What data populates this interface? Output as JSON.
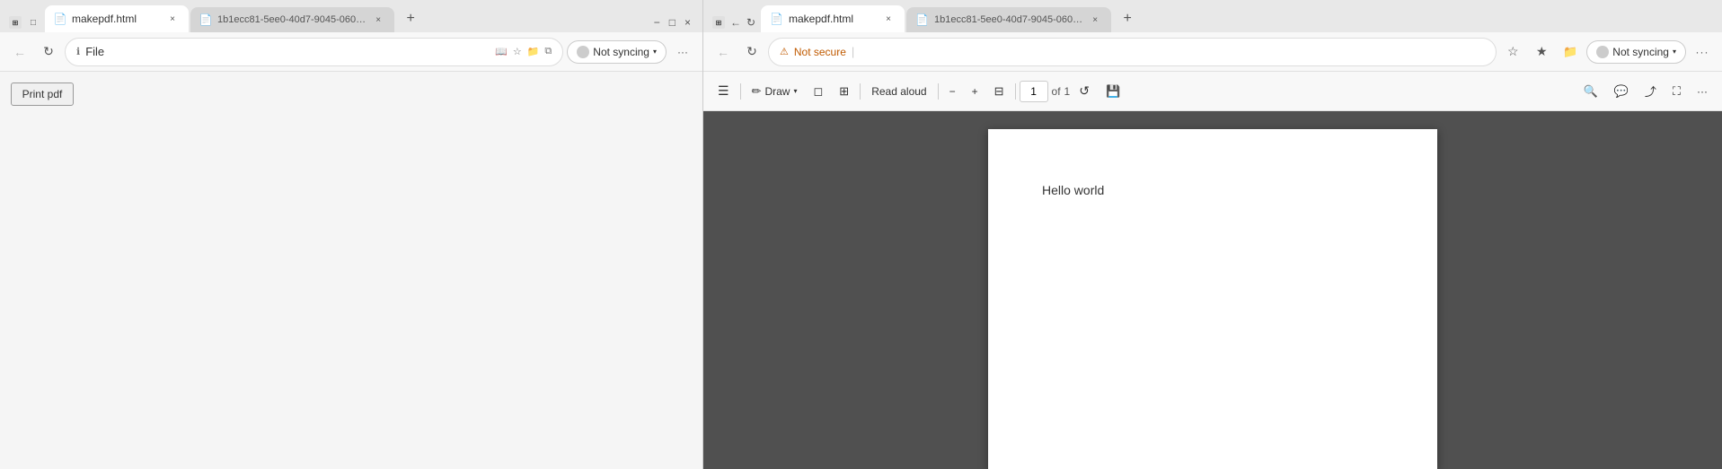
{
  "left_window": {
    "tab_bar": {
      "active_tab": {
        "favicon": "📄",
        "title": "makepdf.html",
        "close_label": "×"
      },
      "inactive_tab": {
        "favicon": "📄",
        "title": "1b1ecc81-5ee0-40d7-9045-060…",
        "close_label": "×"
      },
      "new_tab_label": "+",
      "window_controls": {
        "minimize": "−",
        "maximize": "□",
        "close": "×"
      }
    },
    "nav_bar": {
      "back_label": "←",
      "forward_label": "→",
      "reload_label": "↻",
      "address": {
        "icon_label": "ℹ",
        "value": "File",
        "placeholder": ""
      },
      "not_syncing_label": "Not syncing",
      "not_syncing_chevron": "▾",
      "favorites_icon": "☆",
      "collections_icon": "📁",
      "split_icon": "⧉",
      "more_icon": "···",
      "profile_icon": "👤",
      "star_icon": "★",
      "read_icon": "📖"
    },
    "page_content": {
      "print_pdf_label": "Print pdf"
    }
  },
  "right_window": {
    "tab_bar": {
      "active_tab": {
        "favicon": "📄",
        "title": "makepdf.html",
        "close_label": "×"
      },
      "inactive_tab": {
        "favicon": "📄",
        "title": "1b1ecc81-5ee0-40d7-9045-060…",
        "close_label": "×"
      },
      "new_tab_label": "+",
      "back_label": "←",
      "reload_label": "↻"
    },
    "nav_bar": {
      "back_label": "←",
      "reload_label": "↻",
      "security_icon": "⚠",
      "security_label": "Not secure",
      "address_value": "",
      "not_syncing_label": "Not syncing",
      "not_syncing_chevron": "▾",
      "favorites_icon": "☆",
      "star_icon": "★",
      "collections_icon": "📁",
      "split_icon": "⧉",
      "more_icon": "···"
    },
    "pdf_toolbar": {
      "list_icon": "☰",
      "draw_icon": "✏",
      "draw_label": "Draw",
      "draw_chevron": "▾",
      "erase_icon": "◻",
      "view_icon": "⊞",
      "read_aloud_label": "Read aloud",
      "zoom_out_label": "−",
      "zoom_in_label": "+",
      "fit_page_icon": "⊟",
      "page_current": "1",
      "page_separator": "of",
      "page_total": "1",
      "rotate_icon": "↺",
      "save_icon": "💾",
      "search_icon": "🔍",
      "chat_icon": "💬",
      "share_icon": "⤴",
      "fullscreen_icon": "⛶",
      "more_icon": "···"
    },
    "pdf_viewer": {
      "page_text": "Hello world"
    }
  }
}
